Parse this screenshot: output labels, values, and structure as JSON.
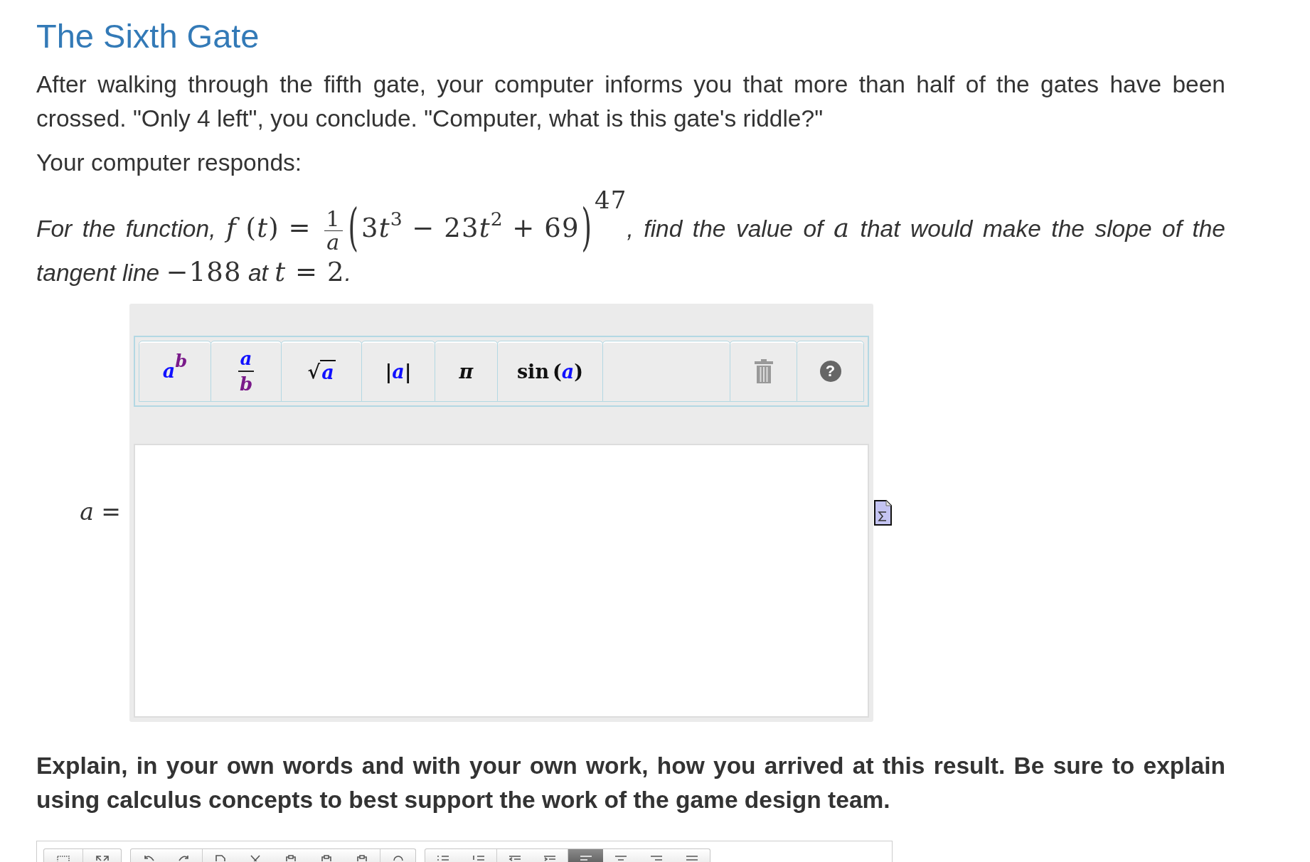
{
  "title": "The Sixth Gate",
  "intro": "After walking through the fifth gate, your computer informs you that more than half of the gates have been crossed. \"Only 4 left\", you conclude. \"Computer, what is this gate's riddle?\"",
  "lead": "Your computer responds:",
  "question": {
    "segments": [
      {
        "kind": "text",
        "text": "For the function, "
      },
      {
        "kind": "math",
        "text": "*f* (*t*) = "
      },
      {
        "kind": "fraction",
        "numerator": "1",
        "denominator": "a"
      },
      {
        "kind": "group",
        "open": "(",
        "body": [
          {
            "kind": "math",
            "text": "3"
          },
          {
            "kind": "var",
            "text": "t"
          },
          {
            "kind": "sup",
            "text": "3"
          },
          {
            "kind": "math",
            "text": " − 23"
          },
          {
            "kind": "var",
            "text": "t"
          },
          {
            "kind": "sup",
            "text": "2"
          },
          {
            "kind": "math",
            "text": " + 69"
          }
        ],
        "close": ")",
        "exponent": "47"
      },
      {
        "kind": "text",
        "text": ", find the value of "
      },
      {
        "kind": "var",
        "text": "a"
      },
      {
        "kind": "text",
        "text": " that would make the slope of the tangent line "
      },
      {
        "kind": "math",
        "text": "−188"
      },
      {
        "kind": "text",
        "text": " at "
      },
      {
        "kind": "math",
        "text": "*t* = 2"
      },
      {
        "kind": "text",
        "text": "."
      }
    ]
  },
  "answer": {
    "label": "*a* =",
    "toolbar": [
      {
        "kind": "power",
        "base": "a",
        "exponent": "b"
      },
      {
        "kind": "fraction",
        "numerator": "a",
        "denominator": "b"
      },
      {
        "kind": "sqrt",
        "radical": "√",
        "radicand": "a"
      },
      {
        "kind": "abs",
        "open": "|",
        "arg": "a",
        "close": "|"
      },
      {
        "kind": "symbol",
        "symbol": "π"
      },
      {
        "kind": "function",
        "name": "sin",
        "open": "(",
        "arg": "a",
        "close": ")"
      },
      {
        "kind": "spacer"
      },
      {
        "kind": "trash"
      },
      {
        "kind": "help",
        "symbol": "?"
      }
    ]
  },
  "explanation": "Explain, in your own words and with your own work, how you arrived at this result. Be sure to explain using calculus concepts to best support the work of the game design team.",
  "editor": {
    "toolbar_groups": [
      {
        "buttons": [
          {
            "selected": false
          },
          {
            "selected": false
          }
        ]
      },
      {
        "buttons": [
          {
            "selected": false
          },
          {
            "selected": false
          },
          {
            "selected": false
          },
          {
            "selected": false
          },
          {
            "selected": false
          },
          {
            "selected": false
          },
          {
            "selected": false
          },
          {
            "selected": false
          }
        ]
      },
      {
        "buttons": [
          {
            "selected": false
          },
          {
            "selected": false
          },
          {
            "selected": false
          },
          {
            "selected": false
          },
          {
            "selected": true
          },
          {
            "selected": false
          },
          {
            "selected": false
          },
          {
            "selected": false
          }
        ]
      }
    ]
  }
}
